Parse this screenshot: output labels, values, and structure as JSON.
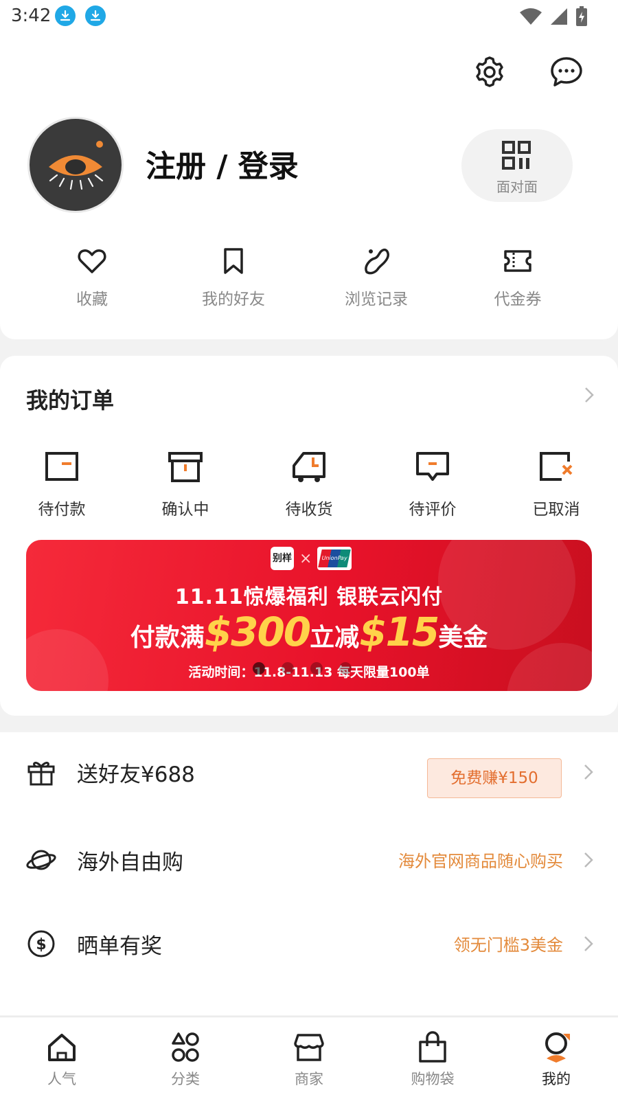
{
  "status_bar": {
    "time": "3:42",
    "icons": [
      "download-icon",
      "download-icon",
      "wifi-icon",
      "signal-icon",
      "battery-charging-icon"
    ]
  },
  "header": {
    "settings_icon": "gear-icon",
    "message_icon": "chat-bubble-icon",
    "login_title": "注册 / 登录",
    "face_to_face_label": "面对面"
  },
  "quick_links": [
    {
      "label": "收藏",
      "icon": "heart-icon"
    },
    {
      "label": "我的好友",
      "icon": "bookmark-icon"
    },
    {
      "label": "浏览记录",
      "icon": "footprint-icon"
    },
    {
      "label": "代金券",
      "icon": "ticket-icon"
    }
  ],
  "orders": {
    "title": "我的订单",
    "items": [
      {
        "label": "待付款",
        "icon": "wallet-icon"
      },
      {
        "label": "确认中",
        "icon": "box-icon"
      },
      {
        "label": "待收货",
        "icon": "truck-icon"
      },
      {
        "label": "待评价",
        "icon": "comment-icon"
      },
      {
        "label": "已取消",
        "icon": "cancel-icon"
      }
    ]
  },
  "banner": {
    "logo_left": "别样",
    "logo_right": "UnionPay",
    "line1": "11.11惊爆福利 银联云闪付",
    "line2_prefix": "付款满",
    "line2_amount1": "$300",
    "line2_middle": "立减",
    "line2_amount2": "$15",
    "line2_suffix": "美金",
    "line3": "活动时间：11.8-11.13 每天限量100单",
    "dots": 4,
    "active_dot": 0
  },
  "menu": [
    {
      "title": "送好友¥688",
      "badge": "免费赚¥150",
      "icon": "gift-icon"
    },
    {
      "title": "海外自由购",
      "right": "海外官网商品随心购买",
      "icon": "planet-icon"
    },
    {
      "title": "晒单有奖",
      "right": "领无门槛3美金",
      "icon": "dollar-icon"
    }
  ],
  "tabs": [
    {
      "label": "人气",
      "icon": "home-icon",
      "active": false
    },
    {
      "label": "分类",
      "icon": "category-icon",
      "active": false
    },
    {
      "label": "商家",
      "icon": "store-icon",
      "active": false
    },
    {
      "label": "购物袋",
      "icon": "shopping-bag-icon",
      "active": false
    },
    {
      "label": "我的",
      "icon": "profile-icon",
      "active": true
    }
  ],
  "colors": {
    "accent": "#e36e2f",
    "orange_text": "#e38a3b",
    "banner_red": "#e8122a",
    "banner_gold": "#ffd24a",
    "icon_dark": "#222222"
  }
}
